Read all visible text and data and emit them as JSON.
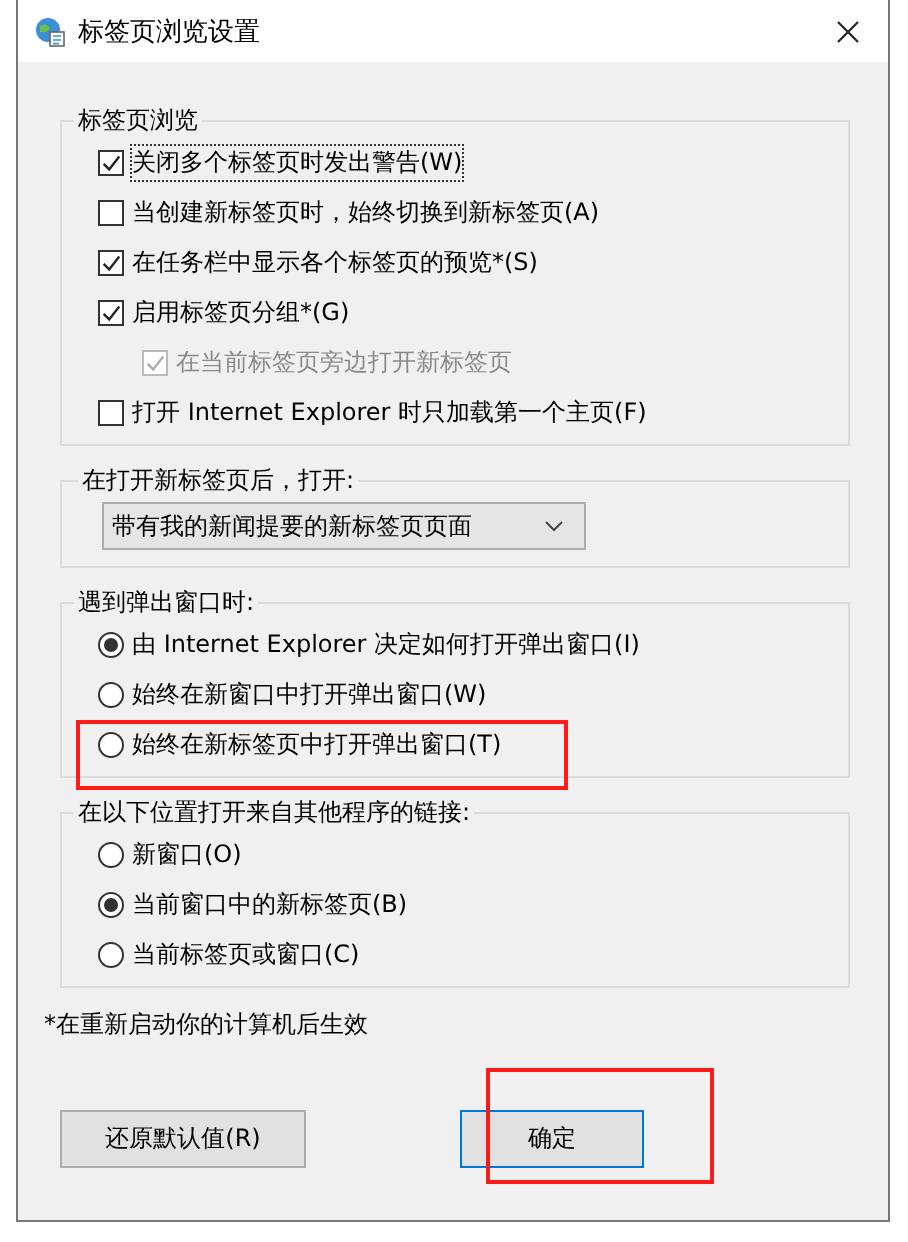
{
  "window": {
    "title": "标签页浏览设置"
  },
  "tab_browsing": {
    "title": "标签页浏览",
    "items": [
      {
        "label": "关闭多个标签页时发出警告(W)",
        "checked": true,
        "disabled": false,
        "focused": true
      },
      {
        "label": "当创建新标签页时，始终切换到新标签页(A)",
        "checked": false,
        "disabled": false,
        "focused": false
      },
      {
        "label": "在任务栏中显示各个标签页的预览*(S)",
        "checked": true,
        "disabled": false,
        "focused": false
      },
      {
        "label": "启用标签页分组*(G)",
        "checked": true,
        "disabled": false,
        "focused": false,
        "children": [
          {
            "label": "在当前标签页旁边打开新标签页",
            "checked": true,
            "disabled": true,
            "focused": false
          }
        ]
      },
      {
        "label": "打开 Internet Explorer 时只加载第一个主页(F)",
        "checked": false,
        "disabled": false,
        "focused": false
      }
    ]
  },
  "new_tab": {
    "title": "在打开新标签页后，打开:",
    "dropdown": {
      "value": "带有我的新闻提要的新标签页页面"
    }
  },
  "popups": {
    "title": "遇到弹出窗口时:",
    "options": [
      {
        "label": "由 Internet Explorer 决定如何打开弹出窗口(I)",
        "selected": true,
        "annotated": false
      },
      {
        "label": "始终在新窗口中打开弹出窗口(W)",
        "selected": false,
        "annotated": false
      },
      {
        "label": "始终在新标签页中打开弹出窗口(T)",
        "selected": false,
        "annotated": true
      }
    ]
  },
  "links": {
    "title": "在以下位置打开来自其他程序的链接:",
    "options": [
      {
        "label": "新窗口(O)",
        "selected": false,
        "annotated": false
      },
      {
        "label": "当前窗口中的新标签页(B)",
        "selected": true,
        "annotated": false
      },
      {
        "label": "当前标签页或窗口(C)",
        "selected": false,
        "annotated": false
      }
    ]
  },
  "footnote": "*在重新启动你的计算机后生效",
  "buttons": [
    {
      "label": "还原默认值(R)",
      "default": false,
      "annotated": false
    },
    {
      "label": "确定",
      "default": true,
      "annotated": true
    }
  ]
}
